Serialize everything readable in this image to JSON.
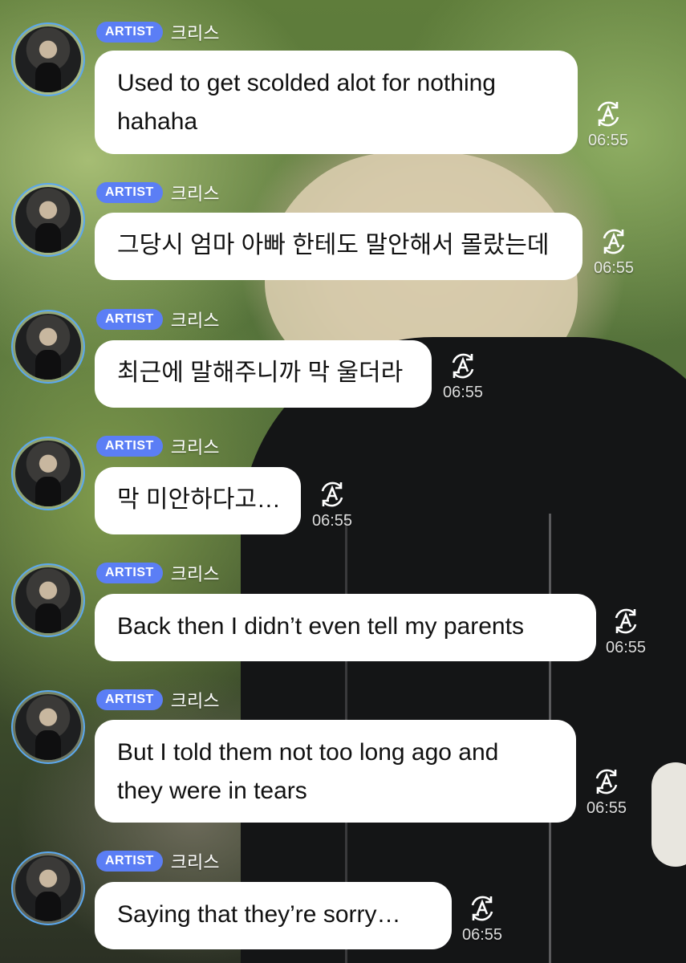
{
  "accent_color": "#5b7ef5",
  "messages": [
    {
      "badge": "ARTIST",
      "sender": "크리스",
      "lines": [
        "Used to get scolded alot for nothing",
        "hahaha"
      ],
      "time": "06:55",
      "icon": "translate-icon"
    },
    {
      "badge": "ARTIST",
      "sender": "크리스",
      "lines": [
        "그당시 엄마 아빠 한테도 말안해서 몰랐는데"
      ],
      "time": "06:55",
      "icon": "translate-icon"
    },
    {
      "badge": "ARTIST",
      "sender": "크리스",
      "lines": [
        "최근에 말해주니까 막 울더라"
      ],
      "time": "06:55",
      "icon": "translate-icon"
    },
    {
      "badge": "ARTIST",
      "sender": "크리스",
      "lines": [
        "막 미안하다고…"
      ],
      "time": "06:55",
      "icon": "translate-icon"
    },
    {
      "badge": "ARTIST",
      "sender": "크리스",
      "lines": [
        "Back then I didn’t even tell my parents"
      ],
      "time": "06:55",
      "icon": "translate-icon"
    },
    {
      "badge": "ARTIST",
      "sender": "크리스",
      "lines": [
        "But I told them not too long ago and",
        "they were in tears"
      ],
      "time": "06:55",
      "icon": "translate-icon"
    },
    {
      "badge": "ARTIST",
      "sender": "크리스",
      "lines": [
        "Saying that they’re sorry…"
      ],
      "time": "06:55",
      "icon": "translate-icon"
    }
  ]
}
